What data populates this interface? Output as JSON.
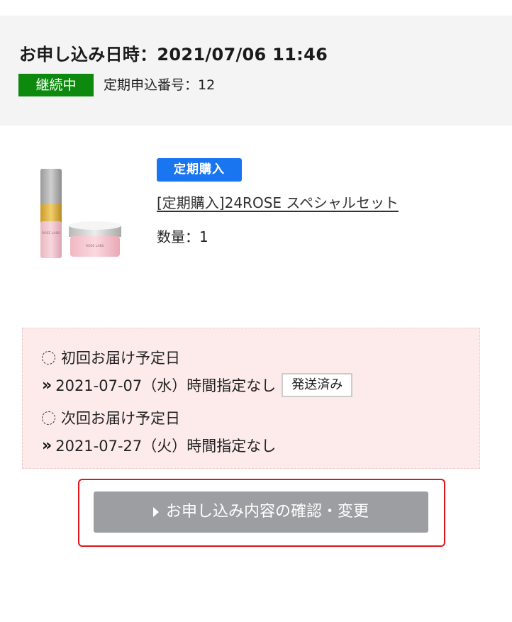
{
  "header": {
    "order_datetime_label": "お申し込み日時：",
    "order_datetime_value": "2021/07/06 11:46",
    "status_badge": "継続中",
    "subscription_number_label": "定期申込番号：",
    "subscription_number_value": "12"
  },
  "product": {
    "image_icon": "product-image",
    "image_brand_text": "ROSE LABO",
    "tag": "定期購入",
    "name": "[定期購入]24ROSE スペシャルセット",
    "quantity_label": "数量：",
    "quantity_value": "1"
  },
  "delivery": {
    "first": {
      "label": "初回お届け予定日",
      "date": "2021-07-07（水）",
      "time": "時間指定なし",
      "status": "発送済み"
    },
    "next": {
      "label": "次回お届け予定日",
      "date": "2021-07-27（火）",
      "time": "時間指定なし"
    }
  },
  "actions": {
    "confirm_change_label": "お申し込み内容の確認・変更"
  },
  "colors": {
    "status_green": "#0d8a0d",
    "tag_blue": "#1a76f0",
    "delivery_bg": "#fdebeb",
    "button_gray": "#9c9ea1",
    "highlight_red": "#e0161d"
  }
}
